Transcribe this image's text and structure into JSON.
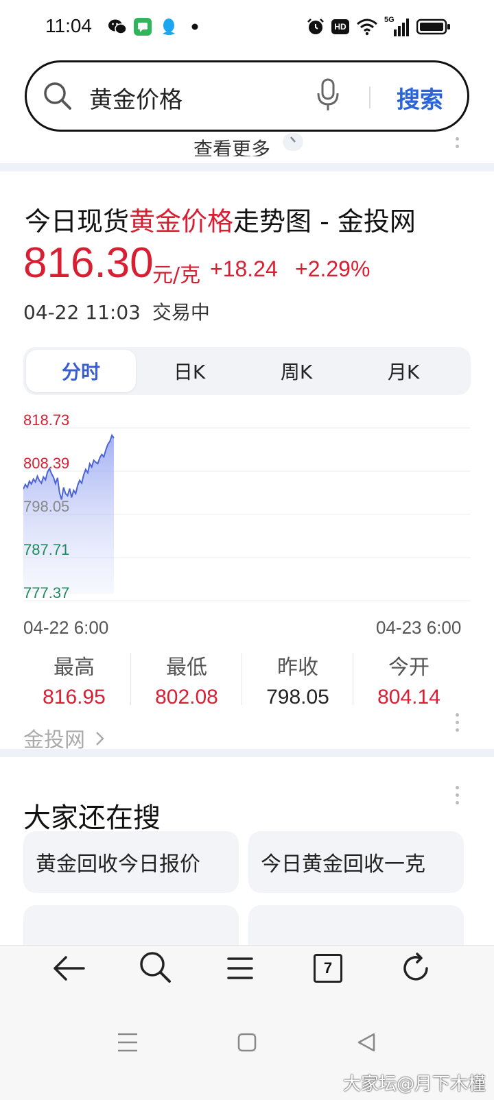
{
  "status_bar": {
    "time": "11:04",
    "icons": [
      "wechat-icon",
      "messages-icon",
      "qq-icon",
      "dot-icon",
      "alarm-icon",
      "hd-icon",
      "wifi-icon",
      "signal-5g-icon",
      "battery-icon"
    ],
    "signal_label": "5G",
    "hd_label": "HD"
  },
  "search": {
    "query": "黄金价格",
    "button_label": "搜索",
    "icons": [
      "search-icon",
      "microphone-icon"
    ]
  },
  "previous_card": {
    "see_more_label": "查看更多"
  },
  "gold_card": {
    "title_prefix": "今日现货",
    "title_highlight": "黄金价格",
    "title_suffix": "走势图 - 金投网",
    "price": "816.30",
    "unit": "元/克",
    "change": "+18.24",
    "change_percent": "+2.29%",
    "datetime": "04-22 11:03",
    "status": "交易中",
    "tabs": [
      {
        "label": "分时",
        "active": true
      },
      {
        "label": "日K",
        "active": false
      },
      {
        "label": "周K",
        "active": false
      },
      {
        "label": "月K",
        "active": false
      }
    ],
    "x_start": "04-22 6:00",
    "x_end": "04-23 6:00",
    "stats": [
      {
        "label": "最高",
        "value": "816.95"
      },
      {
        "label": "最低",
        "value": "802.08"
      },
      {
        "label": "昨收",
        "value": "798.05"
      },
      {
        "label": "今开",
        "value": "804.14"
      }
    ],
    "source_label": "金投网",
    "colors": {
      "up": "#d81e32",
      "neutral": "#888888",
      "down": "#1d8a5a",
      "line": "#4b63d6",
      "accent": "#3a5ed0"
    }
  },
  "chart_data": {
    "type": "area",
    "title": "",
    "xlabel": "",
    "ylabel": "",
    "x_range": [
      "04-22 6:00",
      "04-23 6:00"
    ],
    "y_ticks": [
      818.73,
      808.39,
      798.05,
      787.71,
      777.37
    ],
    "ylim": [
      775.0,
      821.0
    ],
    "grid": true,
    "baseline": 798.05,
    "series": [
      {
        "values": [
          804.1,
          805.2,
          804.5,
          806.0,
          805.3,
          806.5,
          805.8,
          807.2,
          806.1,
          805.5,
          807.0,
          806.3,
          808.2,
          809.0,
          807.8,
          806.9,
          805.4,
          806.8,
          803.2,
          801.6,
          804.5,
          803.0,
          802.5,
          804.2,
          802.08,
          803.8,
          803.0,
          805.0,
          806.2,
          805.5,
          807.5,
          808.8,
          808.0,
          810.2,
          809.4,
          811.0,
          810.5,
          810.2,
          811.6,
          812.4,
          811.8,
          813.5,
          814.8,
          815.5,
          816.95,
          816.3
        ]
      }
    ]
  },
  "related_searches": {
    "title": "大家还在搜",
    "items": [
      "黄金回收今日报价",
      "今日黄金回收一克"
    ]
  },
  "browser_nav": {
    "tab_count": "7",
    "buttons": [
      "back-icon",
      "search-icon",
      "menu-icon",
      "tabs-icon",
      "refresh-icon"
    ]
  },
  "watermark": "大家坛@月下木槿"
}
